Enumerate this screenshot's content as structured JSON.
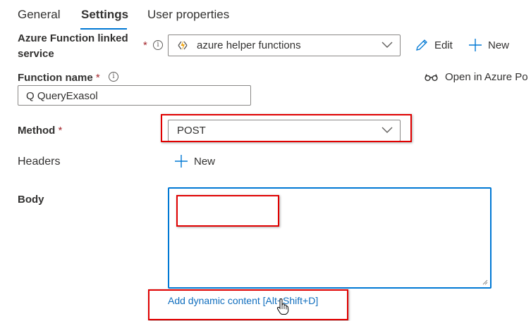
{
  "tabs": [
    {
      "label": "General",
      "active": false
    },
    {
      "label": "Settings",
      "active": true
    },
    {
      "label": "User properties",
      "active": false
    }
  ],
  "linked_service": {
    "label_line1": "Azure Function linked",
    "label_line2": "service",
    "required_mark": "*",
    "info_glyph": "i",
    "selected_value": "azure helper functions",
    "edit_label": "Edit",
    "new_label": "New"
  },
  "function_name": {
    "label": "Function name",
    "required_mark": "*",
    "info_glyph": "i",
    "value": "Q QueryExasol",
    "open_in_portal_label": "Open in Azure Po"
  },
  "method": {
    "label": "Method",
    "required_mark": "*",
    "selected_value": "POST"
  },
  "headers": {
    "label": "Headers",
    "new_label": "New"
  },
  "body": {
    "label": "Body",
    "value": "",
    "dynamic_content_link": "Add dynamic content [Alt+Shift+D]"
  },
  "colors": {
    "accent": "#0078d4",
    "link": "#106ebe",
    "required": "#a4262c",
    "highlight": "#e00000",
    "function_icon": "#f0a30a"
  },
  "icons": [
    "chevron-down-icon",
    "function-bolt-icon",
    "pencil-icon",
    "plus-icon",
    "glasses-icon",
    "info-icon",
    "hand-cursor-icon",
    "resize-grip-icon"
  ]
}
